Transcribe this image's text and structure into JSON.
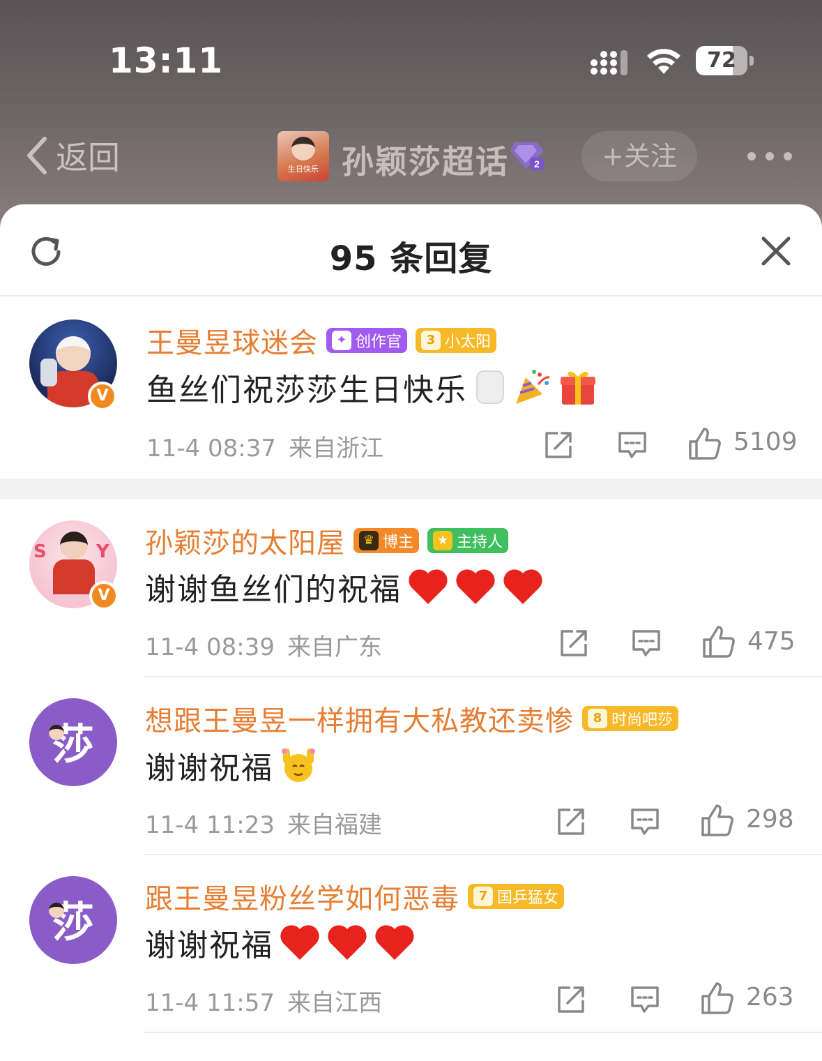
{
  "status_bar": {
    "time": "13:11",
    "battery": "72",
    "battery_fraction": 0.72
  },
  "nav": {
    "back_label": "返回",
    "topic_title": "孙颖莎超话",
    "topic_thumb_caption": "生日快乐",
    "follow_label": "+关注"
  },
  "sheet": {
    "title": "95 条回复"
  },
  "comments": [
    {
      "name": "王曼昱球迷会",
      "tags": [
        {
          "label": "创作官",
          "color": "#9d5af0",
          "icon": "creator-icon"
        },
        {
          "label": "小太阳",
          "level": "3",
          "color": "#f7b927",
          "icon": "level-badge-icon"
        }
      ],
      "text": "鱼丝们祝莎莎生日快乐",
      "emojis": [
        "milk-emoji",
        "party-popper-emoji",
        "gift-emoji"
      ],
      "time": "11-4 08:37",
      "location": "来自浙江",
      "likes": "5109"
    },
    {
      "name": "孙颖莎的太阳屋",
      "tags": [
        {
          "label": "博主",
          "color": "#f28a2a",
          "icon": "crown-icon"
        },
        {
          "label": "主持人",
          "color": "#3fbf5e",
          "icon": "host-icon"
        }
      ],
      "text": "谢谢鱼丝们的祝福",
      "emojis": [
        "heart-emoji",
        "heart-emoji",
        "heart-emoji"
      ],
      "time": "11-4 08:39",
      "location": "来自广东",
      "likes": "475"
    },
    {
      "name": "想跟王曼昱一样拥有大私教还卖惨",
      "tags": [
        {
          "label": "时尚吧莎",
          "level": "8",
          "color": "#f7b927",
          "icon": "level-badge-icon"
        }
      ],
      "text": "谢谢祝福",
      "emojis": [
        "pray-emoji"
      ],
      "time": "11-4 11:23",
      "location": "来自福建",
      "likes": "298"
    },
    {
      "name": "跟王曼昱粉丝学如何恶毒",
      "tags": [
        {
          "label": "国乒猛女",
          "level": "7",
          "color": "#f7b927",
          "icon": "level-badge-icon"
        }
      ],
      "text": "谢谢祝福",
      "emojis": [
        "heart-emoji",
        "heart-emoji",
        "heart-emoji"
      ],
      "time": "11-4 11:57",
      "location": "来自江西",
      "likes": "263"
    }
  ],
  "icons": {
    "share": "share-icon",
    "reply": "comment-icon",
    "like": "thumbs-up-icon"
  },
  "colors": {
    "accent": "#e67e33",
    "verified": "#f08a1e",
    "avatar_purple": "#8a5cc7"
  }
}
